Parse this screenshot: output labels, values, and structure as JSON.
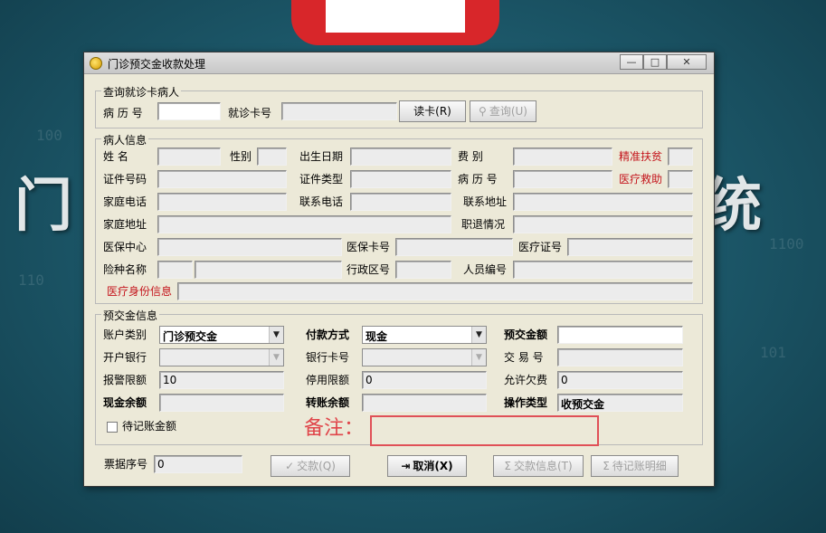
{
  "background": {
    "text_left": "门",
    "text_right": "统",
    "deco_numbers": [
      "110",
      "100",
      "101",
      "1100"
    ]
  },
  "window": {
    "title": "门诊预交金收款处理",
    "buttons": {
      "minimize": "—",
      "maximize": "□",
      "close": "✕"
    }
  },
  "query": {
    "title": "查询就诊卡病人",
    "record_no_label": "病 历 号",
    "record_no_value": "",
    "card_no_label": "就诊卡号",
    "card_no_value": "",
    "read_card_button": "读卡(R)",
    "query_button": "查询(U)"
  },
  "patient": {
    "title": "病人信息",
    "name_label": "姓    名",
    "gender_label": "性别",
    "birth_label": "出生日期",
    "fee_type_label": "费    别",
    "poverty_label": "精准扶贫",
    "id_no_label": "证件号码",
    "id_type_label": "证件类型",
    "record_no_label": "病 历 号",
    "medical_aid_label": "医疗救助",
    "home_phone_label": "家庭电话",
    "contact_phone_label": "联系电话",
    "contact_addr_label": "联系地址",
    "home_addr_label": "家庭地址",
    "retire_label": "职退情况",
    "insurance_center_label": "医保中心",
    "insurance_card_label": "医保卡号",
    "medical_cert_label": "医疗证号",
    "insurance_type_label": "险种名称",
    "region_label": "行政区号",
    "staff_no_label": "人员编号",
    "medical_identity_label": "医疗身份信息"
  },
  "deposit": {
    "title": "预交金信息",
    "account_type_label": "账户类别",
    "account_type_value": "门诊预交金",
    "pay_method_label": "付款方式",
    "pay_method_value": "现金",
    "deposit_amount_label": "预交金额",
    "deposit_amount_value": "",
    "bank_label": "开户银行",
    "bank_card_label": "银行卡号",
    "trade_no_label": "交 易 号",
    "alert_limit_label": "报警限额",
    "alert_limit_value": "10",
    "stop_limit_label": "停用限额",
    "stop_limit_value": "0",
    "allow_owe_label": "允许欠费",
    "allow_owe_value": "0",
    "cash_balance_label": "现金余额",
    "transfer_balance_label": "转账余额",
    "op_type_label": "操作类型",
    "op_type_value": "收预交金",
    "pending_label": "待记账金额",
    "remark_label": "备注："
  },
  "bottom": {
    "bill_no_label": "票据序号",
    "bill_no_value": "0",
    "pay_button": "交款(Q)",
    "cancel_button": "取消(X)",
    "pay_info_button": "交款信息(T)",
    "pending_detail_button": "待记账明细"
  }
}
